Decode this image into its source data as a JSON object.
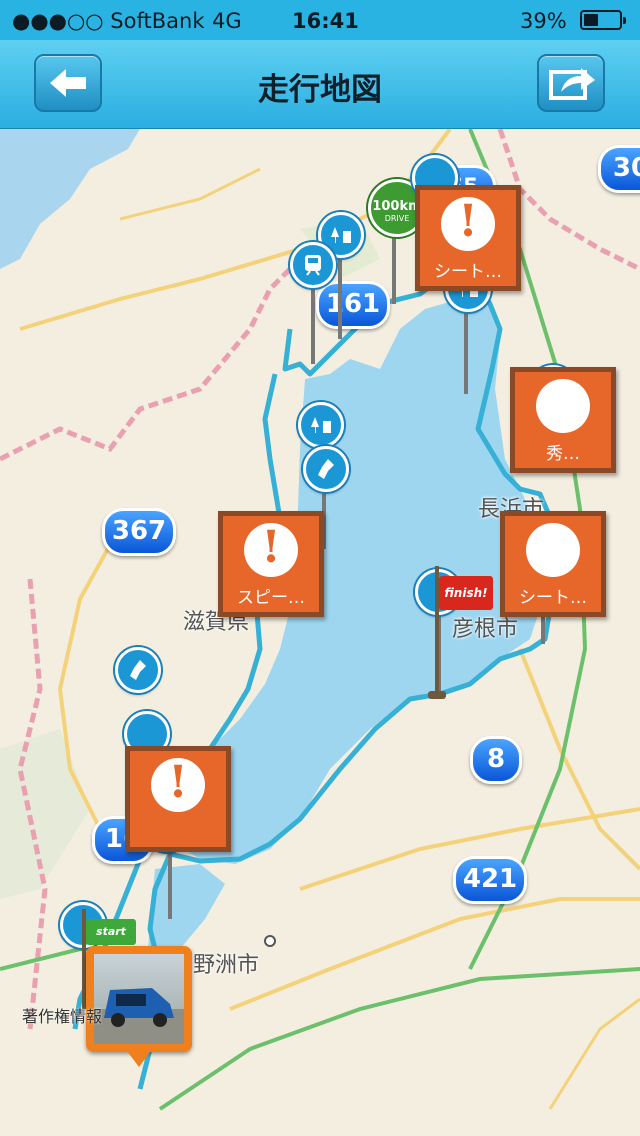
{
  "status": {
    "carrier": "●●●○○ SoftBank",
    "network": "4G",
    "time": "16:41",
    "battery": "39%",
    "battery_level": 0.39
  },
  "nav": {
    "title": "走行地図",
    "back_icon": "back-arrow-icon",
    "share_icon": "share-arrow-icon"
  },
  "map": {
    "routes": [
      "161",
      "367",
      "8",
      "421",
      "30",
      "65",
      "16"
    ],
    "places": {
      "shiga": "滋賀県",
      "nagahama": "長浜市",
      "hikone": "彦根市",
      "yasu": "野洲市"
    },
    "signs": {
      "seat1": "シート…",
      "speed1": "スピー…",
      "hide": "秀…",
      "seat2": "シート…"
    },
    "badges": {
      "drive": "100km",
      "drive_sub": "DRIVE",
      "finish": "finish!",
      "start": "start"
    },
    "credit": "著作権情報"
  },
  "colors": {
    "route": "#37b0d6",
    "lake": "#9ed6f0",
    "board": "#e7672b"
  }
}
